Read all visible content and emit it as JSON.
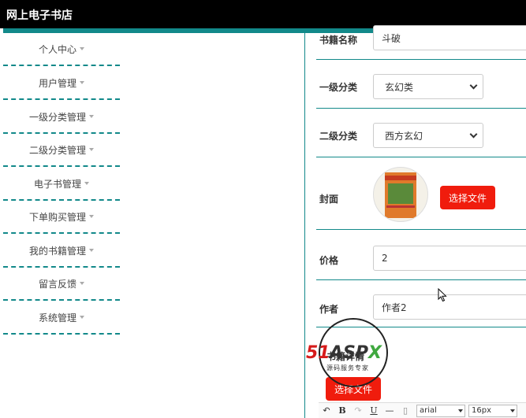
{
  "header": {
    "title": "网上电子书店"
  },
  "sidebar": {
    "items": [
      {
        "label": "个人中心"
      },
      {
        "label": "用户管理"
      },
      {
        "label": "一级分类管理"
      },
      {
        "label": "二级分类管理"
      },
      {
        "label": "电子书管理"
      },
      {
        "label": "下单购买管理"
      },
      {
        "label": "我的书籍管理"
      },
      {
        "label": "留言反馈"
      },
      {
        "label": "系统管理"
      }
    ]
  },
  "form": {
    "book_name": {
      "label": "书籍名称",
      "value": "斗破"
    },
    "category1": {
      "label": "一级分类",
      "value": "玄幻类"
    },
    "category2": {
      "label": "二级分类",
      "value": "西方玄幻"
    },
    "cover": {
      "label": "封面",
      "button": "选择文件"
    },
    "price": {
      "label": "价格",
      "value": "2"
    },
    "author": {
      "label": "作者",
      "value": "作者2"
    },
    "detail": {
      "label": "书籍详情",
      "button": "选择文件"
    }
  },
  "editor_toolbar": {
    "font": "arial",
    "size": "16px",
    "icons": [
      "undo-icon",
      "bold-icon",
      "redo-icon",
      "underline-icon",
      "horizontal-rule-icon",
      "document-icon"
    ]
  },
  "watermark": {
    "brand_red": "51",
    "brand_dark": "ASP",
    "brand_green": "X",
    "subtitle": "源码服务专家"
  },
  "colors": {
    "teal": "#12898a",
    "header": "#000000",
    "button_red": "#f01c0d"
  }
}
